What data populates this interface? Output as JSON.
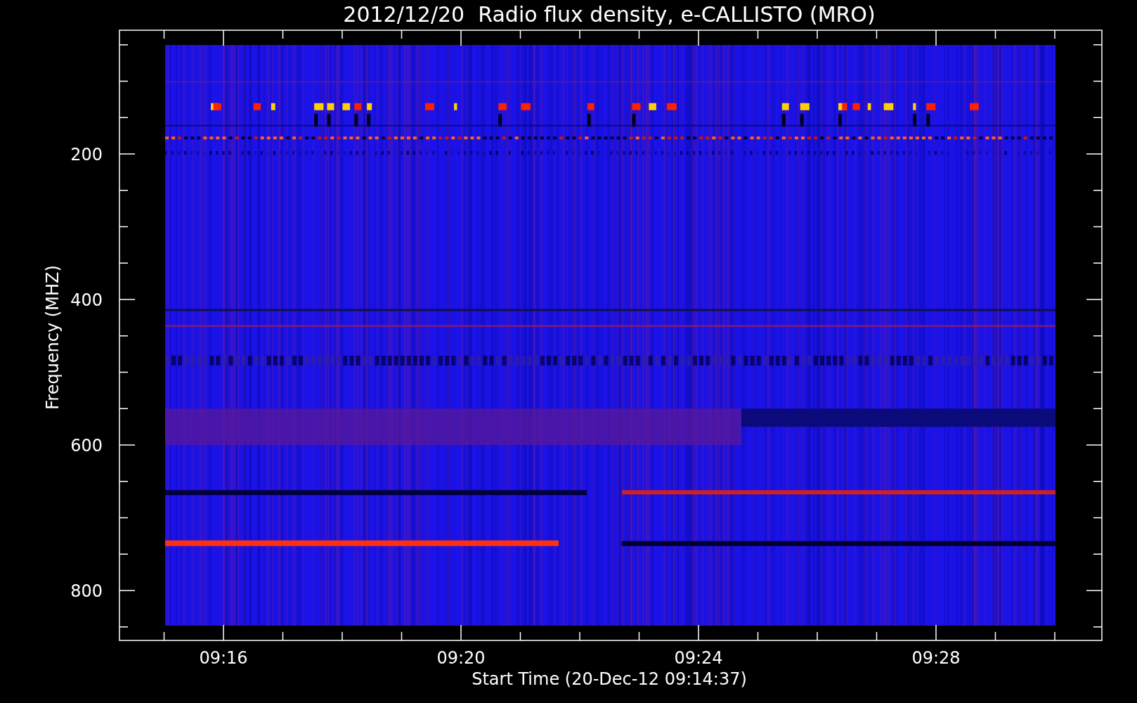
{
  "title": "2012/12/20  Radio flux density, e-CALLISTO (MRO)",
  "y_axis": {
    "label": "Frequency (MHZ)",
    "ticks": [
      "200",
      "400",
      "600",
      "800"
    ]
  },
  "x_axis": {
    "label": "Start Time (20-Dec-12 09:14:37)",
    "ticks": [
      "09:16",
      "09:20",
      "09:24",
      "09:28"
    ]
  }
}
